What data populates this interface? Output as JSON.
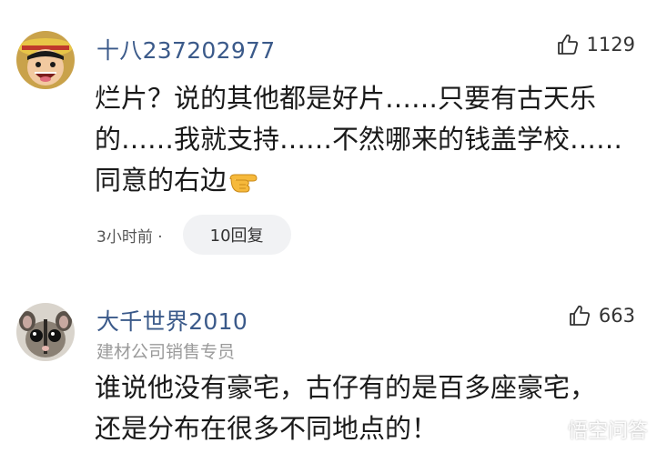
{
  "comments": [
    {
      "username": "十八237202977",
      "likes": "1129",
      "avatar": "luffy-avatar",
      "lines": [
        "烂片？说的其他都是好片……只要有古天乐",
        "的……我就支持……不然哪来的钱盖学校……",
        "同意的右边"
      ],
      "emoji": "pointing-right-emoji",
      "time": "3小时前 ·",
      "replies": "10回复"
    },
    {
      "username": "大千世界2010",
      "subtitle": "建材公司销售专员",
      "likes": "663",
      "avatar": "sugar-glider-avatar",
      "lines": [
        "谁说他没有豪宅，古仔有的是百多座豪宅，",
        "还是分布在很多不同地点的！"
      ]
    }
  ],
  "watermark": {
    "text": "悟空问答",
    "icon": "wukong-logo-icon"
  },
  "colors": {
    "username": "#3b5a8a",
    "subtitle": "#9a9a9a",
    "text": "#1a1a1a",
    "reply_bg": "#f1f2f4"
  }
}
